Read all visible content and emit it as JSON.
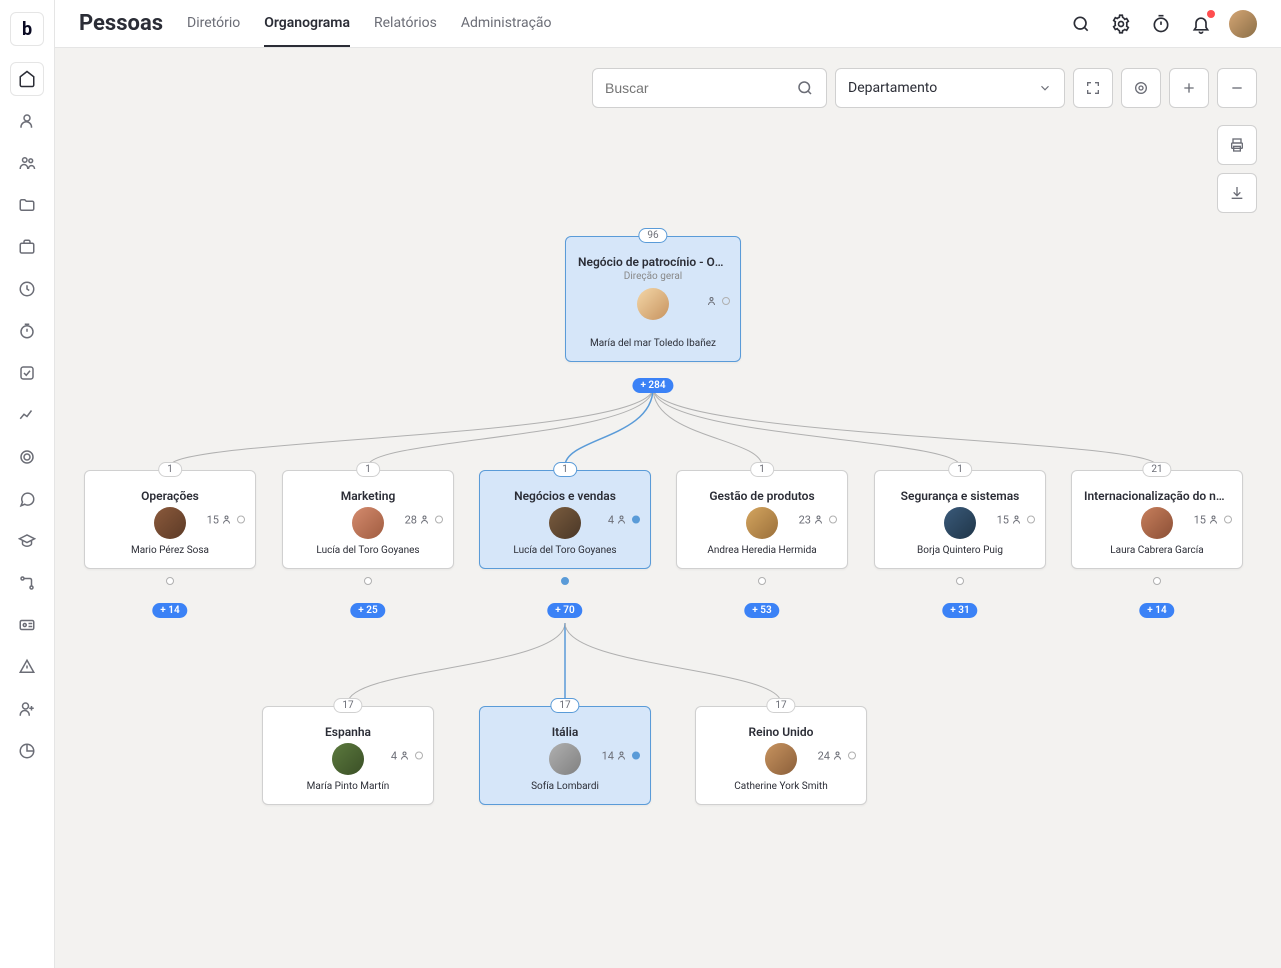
{
  "header": {
    "title": "Pessoas",
    "tabs": [
      "Diretório",
      "Organograma",
      "Relatórios",
      "Administração"
    ],
    "active_tab": 1
  },
  "controls": {
    "search_placeholder": "Buscar",
    "filter_label": "Departamento"
  },
  "root": {
    "badge": "96",
    "title": "Negócio de patrocínio - Operaci...",
    "subtitle": "Direção geral",
    "name": "María del mar Toledo Ibañez",
    "expand": "+ 284"
  },
  "level2": [
    {
      "badge": "1",
      "title": "Operações",
      "count": "15",
      "name": "Mario Pérez Sosa",
      "expand": "+ 14",
      "avatar": "av2"
    },
    {
      "badge": "1",
      "title": "Marketing",
      "count": "28",
      "name": "Lucía del Toro Goyanes",
      "expand": "+ 25",
      "avatar": "av3"
    },
    {
      "badge": "1",
      "title": "Negócios e vendas",
      "count": "4",
      "name": "Lucía del Toro Goyanes",
      "expand": "+ 70",
      "avatar": "av4",
      "selected": true
    },
    {
      "badge": "1",
      "title": "Gestão de produtos",
      "count": "23",
      "name": "Andrea Heredia Hermida",
      "expand": "+ 53",
      "avatar": "av5"
    },
    {
      "badge": "1",
      "title": "Segurança e sistemas",
      "count": "15",
      "name": "Borja Quintero Puig",
      "expand": "+ 31",
      "avatar": "av6"
    },
    {
      "badge": "21",
      "title": "Internacionalização do negócio...",
      "count": "15",
      "name": "Laura Cabrera García",
      "expand": "+ 14",
      "avatar": "av7"
    }
  ],
  "level3": [
    {
      "badge": "17",
      "title": "Espanha",
      "count": "4",
      "name": "María Pinto Martín",
      "avatar": "av8"
    },
    {
      "badge": "17",
      "title": "Itália",
      "count": "14",
      "name": "Sofía Lombardi",
      "avatar": "av9",
      "selected": true
    },
    {
      "badge": "17",
      "title": "Reino Unido",
      "count": "24",
      "name": "Catherine York Smith",
      "avatar": "av10"
    }
  ]
}
